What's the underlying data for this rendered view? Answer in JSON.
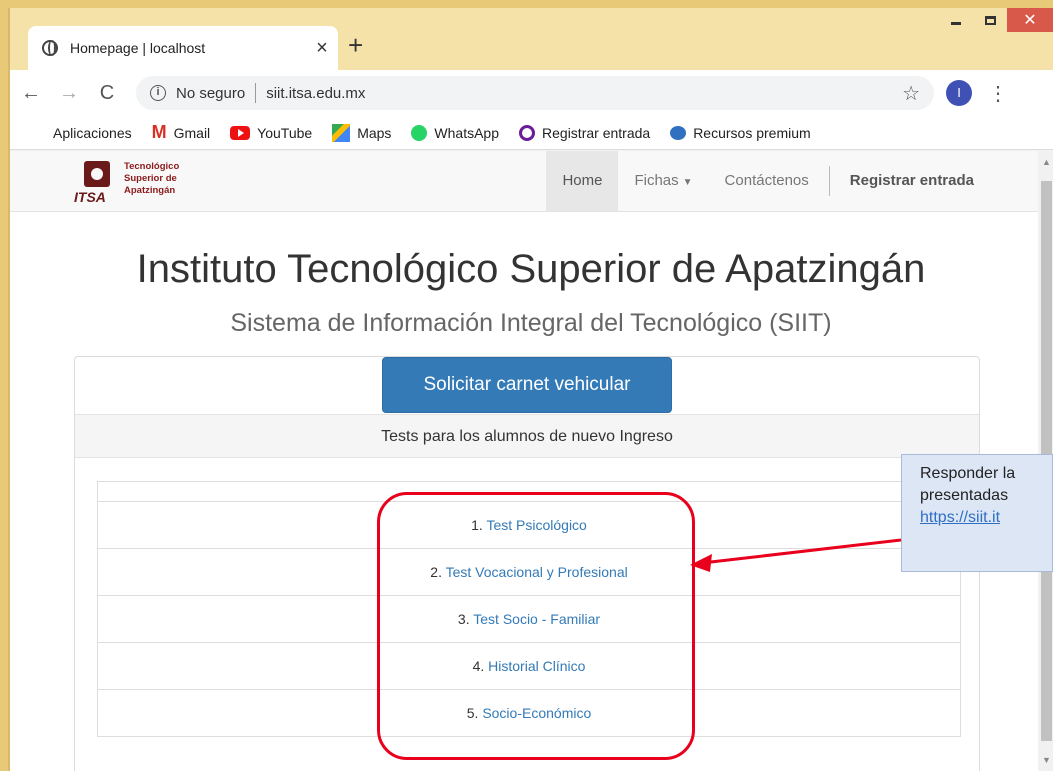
{
  "browser": {
    "tab_title": "Homepage | localhost",
    "tab_close": "×",
    "new_tab": "+",
    "security_label": "No seguro",
    "url": "siit.itsa.edu.mx",
    "profile_initial": "I",
    "bookmarks": [
      {
        "label": "Aplicaciones",
        "icon": "apps-icon"
      },
      {
        "label": "Gmail",
        "icon": "gmail-icon"
      },
      {
        "label": "YouTube",
        "icon": "youtube-icon"
      },
      {
        "label": "Maps",
        "icon": "maps-icon"
      },
      {
        "label": "WhatsApp",
        "icon": "whatsapp-icon"
      },
      {
        "label": "Registrar entrada",
        "icon": "registrar-icon"
      },
      {
        "label": "Recursos premium",
        "icon": "recursos-icon"
      }
    ]
  },
  "site": {
    "logo_abbr": "ITSA",
    "logo_line1": "Tecnológico",
    "logo_line2": "Superior de",
    "logo_line3": "Apatzingán",
    "nav": {
      "home": "Home",
      "fichas": "Fichas",
      "contact": "Contáctenos",
      "register": "Registrar entrada"
    }
  },
  "main": {
    "title": "Instituto Tecnológico Superior de Apatzingán",
    "subtitle": "Sistema de Información Integral del Tecnológico (SIIT)",
    "carnet_button": "Solicitar carnet vehicular",
    "panel_heading": "Tests para los alumnos de nuevo Ingreso",
    "tests": [
      {
        "num": "1.",
        "label": "Test Psicológico"
      },
      {
        "num": "2.",
        "label": "Test Vocacional y Profesional"
      },
      {
        "num": "3.",
        "label": "Test Socio - Familiar"
      },
      {
        "num": "4.",
        "label": "Historial Clínico"
      },
      {
        "num": "5.",
        "label": "Socio-Económico"
      }
    ]
  },
  "annotation": {
    "line1": "Responder la",
    "line2": "presentadas",
    "link": "https://siit.it"
  },
  "colors": {
    "accent": "#337ab7",
    "highlight": "#e8001c"
  }
}
